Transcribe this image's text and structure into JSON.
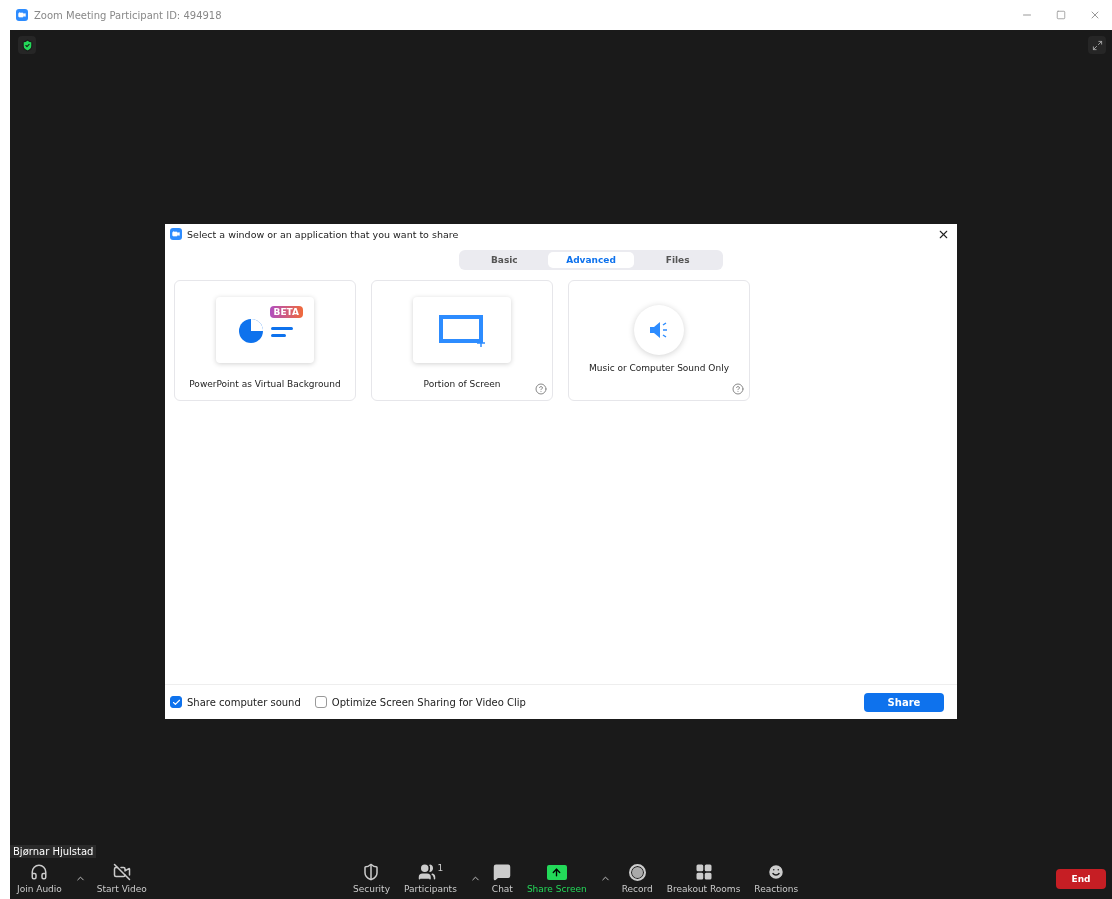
{
  "window": {
    "title": "Zoom Meeting Participant ID: 494918"
  },
  "dialog": {
    "title": "Select a window or an application that you want to share",
    "tabs": [
      {
        "label": "Basic",
        "selected": false
      },
      {
        "label": "Advanced",
        "selected": true
      },
      {
        "label": "Files",
        "selected": false
      }
    ],
    "options": [
      {
        "kind": "powerpoint",
        "label": "PowerPoint as Virtual Background",
        "badge": "BETA",
        "help": false
      },
      {
        "kind": "portion",
        "label": "Portion of Screen",
        "help": true
      },
      {
        "kind": "sound",
        "label": "Music or Computer Sound Only",
        "help": true
      }
    ],
    "checkboxes": [
      {
        "label": "Share computer sound",
        "checked": true
      },
      {
        "label": "Optimize Screen Sharing for Video Clip",
        "checked": false
      }
    ],
    "share_button": "Share"
  },
  "name_tag": "Bjørnar Hjulstad",
  "toolbar": {
    "left": [
      {
        "kind": "audio",
        "label": "Join Audio",
        "caret": true,
        "active": false
      },
      {
        "kind": "video",
        "label": "Start Video",
        "caret": false,
        "active": false
      }
    ],
    "center": [
      {
        "kind": "security",
        "label": "Security",
        "caret": false,
        "active": false
      },
      {
        "kind": "participants",
        "label": "Participants",
        "count": "1",
        "caret": true,
        "active": false
      },
      {
        "kind": "chat",
        "label": "Chat",
        "caret": false,
        "active": false
      },
      {
        "kind": "share",
        "label": "Share Screen",
        "caret": true,
        "active": true
      },
      {
        "kind": "record",
        "label": "Record",
        "caret": false,
        "active": false
      },
      {
        "kind": "breakout",
        "label": "Breakout Rooms",
        "caret": false,
        "active": false
      },
      {
        "kind": "reactions",
        "label": "Reactions",
        "caret": false,
        "active": false
      }
    ],
    "end_button": "End"
  }
}
